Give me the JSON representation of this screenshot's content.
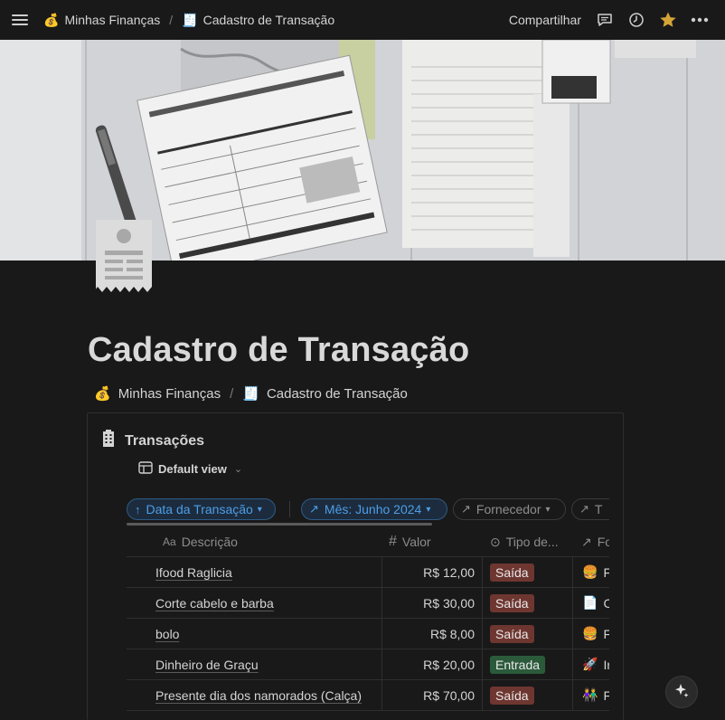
{
  "topbar": {
    "breadcrumbs": [
      {
        "emoji": "💰",
        "label": "Minhas Finanças"
      },
      {
        "emoji": "🧾",
        "label": "Cadastro de Transação"
      }
    ],
    "separator": "/",
    "share_label": "Compartilhar",
    "icons": [
      "menu-icon",
      "comment-icon",
      "history-icon",
      "star-icon",
      "more-icon"
    ]
  },
  "page": {
    "title": "Cadastro de Transação",
    "breadcrumbs": [
      {
        "emoji": "💰",
        "label": "Minhas Finanças"
      },
      {
        "emoji": "🧾",
        "label": "Cadastro de Transação"
      }
    ],
    "separator": "/"
  },
  "database": {
    "title": "Transações",
    "view_label": "Default view",
    "filters": [
      {
        "label": "Data da Transação",
        "icon": "↑",
        "active": true
      },
      {
        "label": "Mês: Junho 2024",
        "icon": "↗",
        "active": true
      },
      {
        "label": "Fornecedor",
        "icon": "↗",
        "active": false
      },
      {
        "label": "T",
        "icon": "↗",
        "active": false
      }
    ],
    "columns": [
      {
        "icon": "Aa",
        "label": "Descrição"
      },
      {
        "icon": "#",
        "label": "Valor"
      },
      {
        "icon": "⊙",
        "label": "Tipo de..."
      },
      {
        "icon": "↗",
        "label": "Fo"
      }
    ],
    "rows": [
      {
        "descricao": "Ifood Raglicia",
        "valor": "R$ 12,00",
        "tipo": "Saída",
        "forn_emoji": "🍔",
        "forn": "F"
      },
      {
        "descricao": "Corte cabelo e barba",
        "valor": "R$ 30,00",
        "tipo": "Saída",
        "forn_emoji": "📄",
        "forn": "C"
      },
      {
        "descricao": "bolo",
        "valor": "R$ 8,00",
        "tipo": "Saída",
        "forn_emoji": "🍔",
        "forn": "F"
      },
      {
        "descricao": "Dinheiro de Graçu",
        "valor": "R$ 20,00",
        "tipo": "Entrada",
        "forn_emoji": "🚀",
        "forn": "Ir"
      },
      {
        "descricao": "Presente dia dos namorados (Calça)",
        "valor": "R$ 70,00",
        "tipo": "Saída",
        "forn_emoji": "👫",
        "forn": "F"
      }
    ]
  },
  "colors": {
    "background": "#191919",
    "saida_tag": "#6e3630",
    "entrada_tag": "#2b5a3b",
    "filter_active": "#4d9ee8"
  }
}
